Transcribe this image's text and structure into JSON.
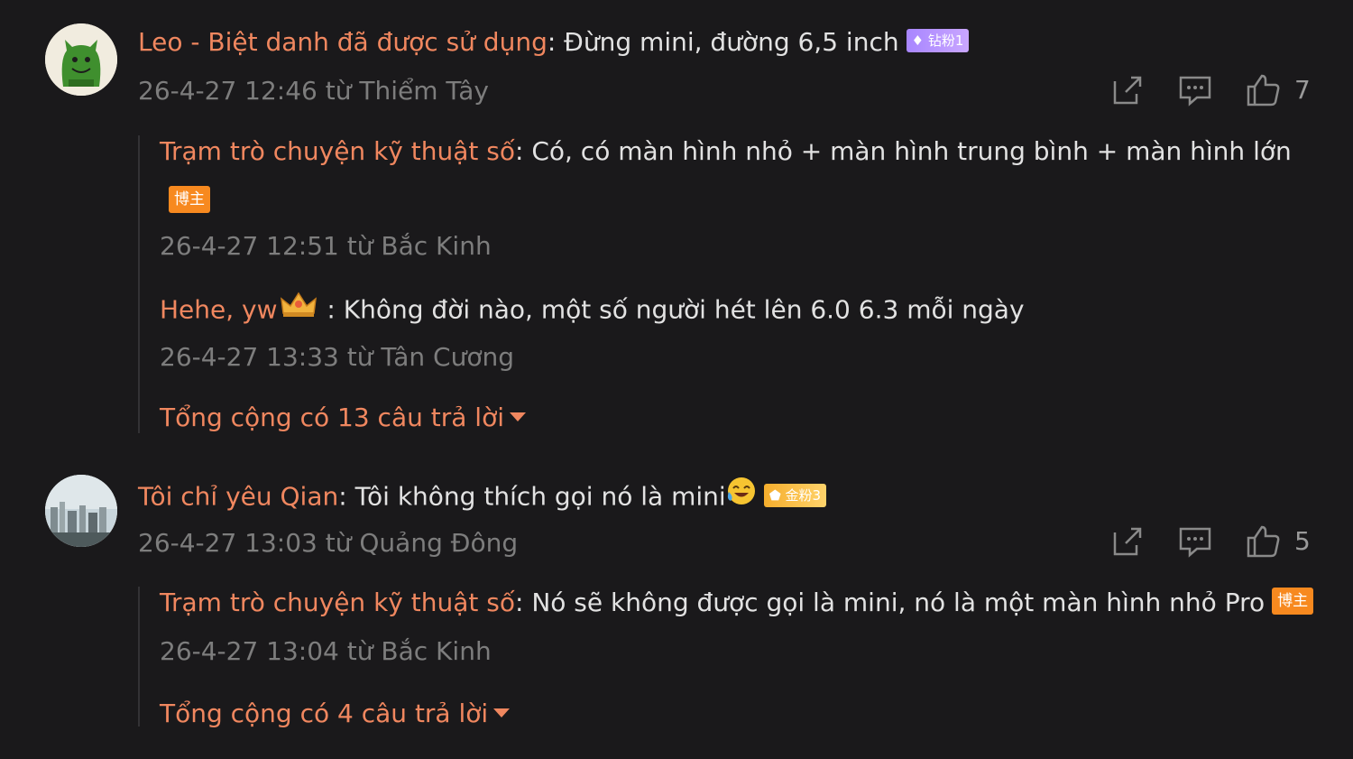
{
  "comments": [
    {
      "author": "Leo - Biệt danh đã được sử dụng",
      "separator": ":",
      "text": " Đừng mini, đường 6,5 inch",
      "badge": "钻粉1",
      "meta": "26-4-27 12:46 từ Thiểm Tây",
      "likes": "7",
      "replies": [
        {
          "author": "Trạm trò chuyện kỹ thuật số",
          "separator": ":",
          "text": " Có, có màn hình nhỏ + màn hình trung bình + màn hình lớn",
          "badge": "博主",
          "meta": "26-4-27 12:51 từ Bắc Kinh"
        },
        {
          "author": "Hehe, yw",
          "separator": " :",
          "text": " Không đời nào, một số người hét lên 6.0 6.3 mỗi ngày",
          "meta": "26-4-27 13:33 từ Tân Cương"
        }
      ],
      "more_label": "Tổng cộng có 13 câu trả lời"
    },
    {
      "author": "Tôi chỉ yêu Qian",
      "separator": ":",
      "text": " Tôi không thích gọi nó là mini",
      "badge": "金粉3",
      "meta": "26-4-27 13:03 từ Quảng Đông",
      "likes": "5",
      "replies": [
        {
          "author": "Trạm trò chuyện kỹ thuật số",
          "separator": ":",
          "text": " Nó sẽ không được gọi là mini, nó là một màn hình nhỏ Pro",
          "badge": "博主",
          "meta": "26-4-27 13:04 từ Bắc Kinh"
        }
      ],
      "more_label": "Tổng cộng có 4 câu trả lời"
    }
  ],
  "icons": {
    "share": "share-icon",
    "reply": "comment-icon",
    "like": "thumbs-up-icon"
  },
  "colors": {
    "background": "#1a191b",
    "author": "#f0875f",
    "meta": "#7d7d7d",
    "text": "#e2e2e2"
  }
}
